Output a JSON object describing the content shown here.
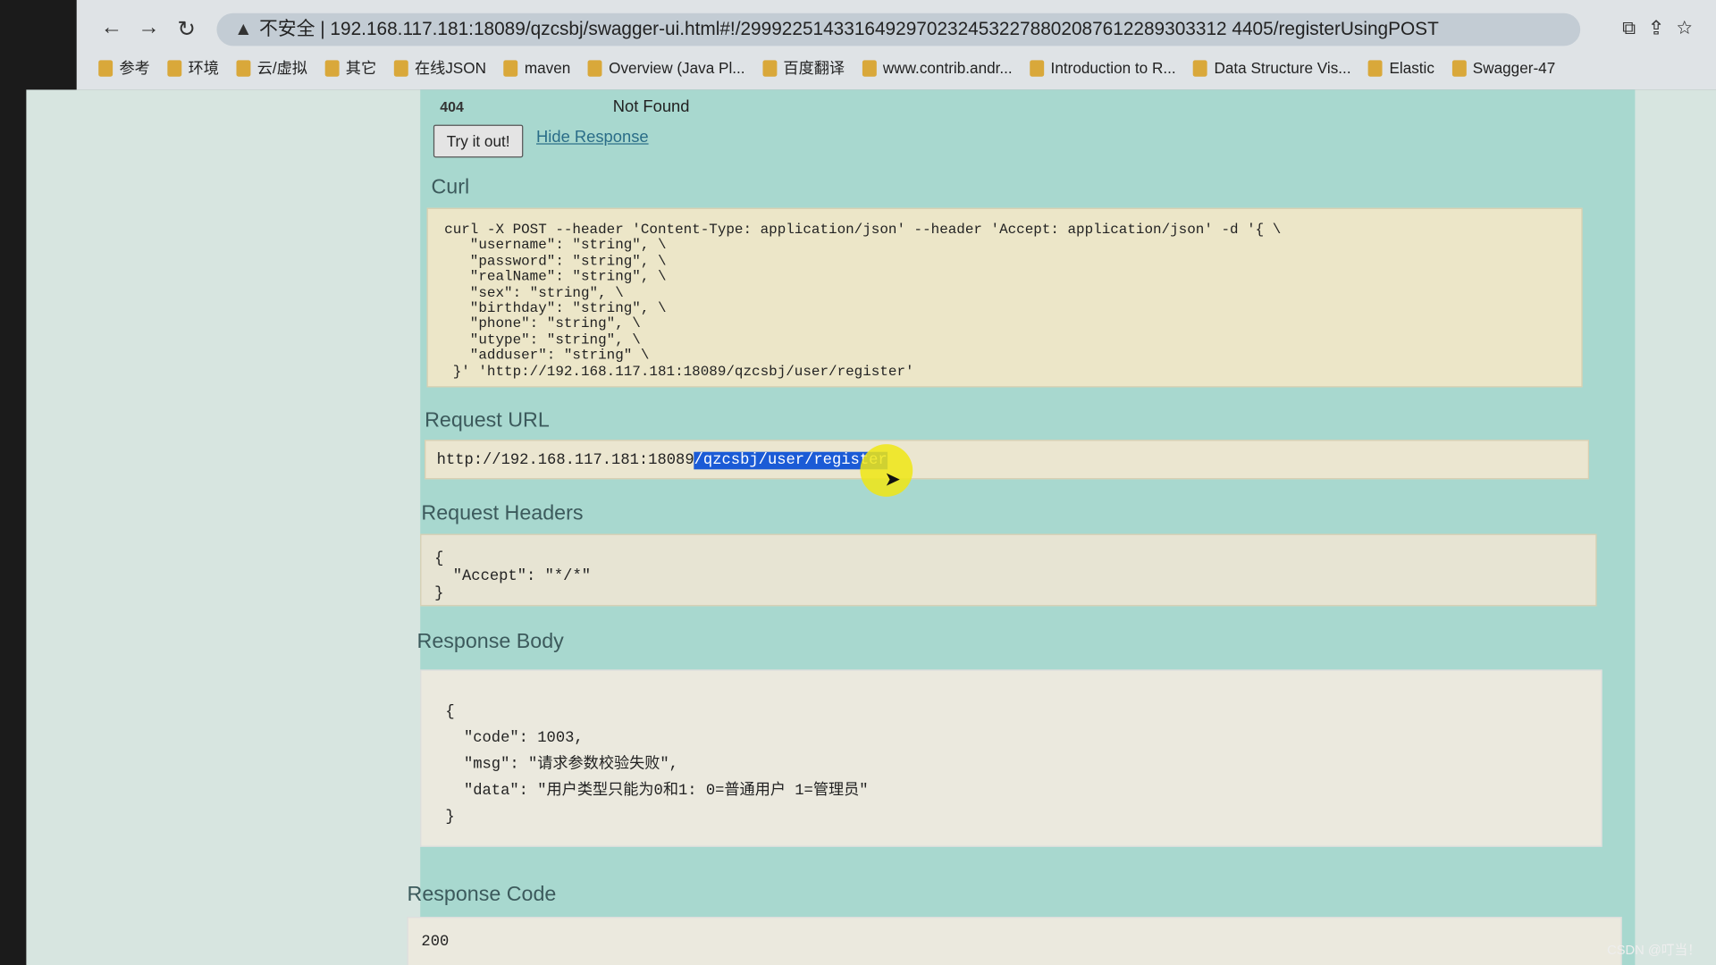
{
  "browser": {
    "url_warning": "不安全",
    "url": "192.168.117.181:18089/qzcsbj/swagger-ui.html#!/29992251433164929702324532278802087612289303312 4405/registerUsingPOST",
    "bookmarks": [
      "参考",
      "环境",
      "云/虚拟",
      "其它",
      "在线JSON",
      "maven",
      "Overview (Java Pl...",
      "百度翻译",
      "www.contrib.andr...",
      "Introduction to R...",
      "Data Structure Vis...",
      "Elastic",
      "Swagger-47"
    ]
  },
  "response_status": {
    "code": "404",
    "text": "Not Found"
  },
  "buttons": {
    "try_it": "Try it out!",
    "hide_response": "Hide Response"
  },
  "sections": {
    "curl": "Curl",
    "request_url": "Request URL",
    "request_headers": "Request Headers",
    "response_body": "Response Body",
    "response_code": "Response Code"
  },
  "curl_text": "curl -X POST --header 'Content-Type: application/json' --header 'Accept: application/json' -d '{ \\\n   \"username\": \"string\", \\\n   \"password\": \"string\", \\\n   \"realName\": \"string\", \\\n   \"sex\": \"string\", \\\n   \"birthday\": \"string\", \\\n   \"phone\": \"string\", \\\n   \"utype\": \"string\", \\\n   \"adduser\": \"string\" \\\n }' 'http://192.168.117.181:18089/qzcsbj/user/register'",
  "request_url": {
    "base": "http://192.168.117.181:18089",
    "selected_path": "/qzcsbj/user/register"
  },
  "request_headers_text": "{\n  \"Accept\": \"*/*\"\n}",
  "response_body_text": "{\n  \"code\": 1003,\n  \"msg\": \"请求参数校验失败\",\n  \"data\": \"用户类型只能为0和1: 0=普通用户 1=管理员\"\n}",
  "response_code": "200",
  "watermark": "CSDN @叮当！"
}
